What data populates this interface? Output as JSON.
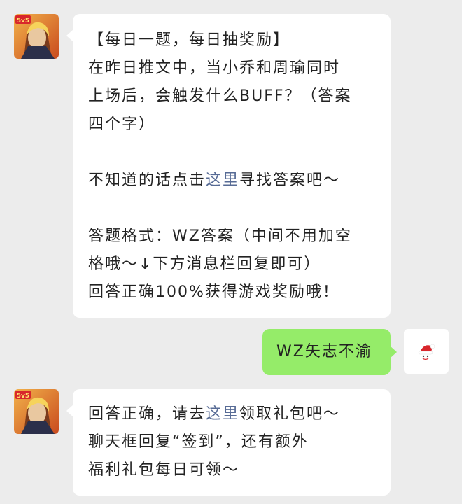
{
  "messages": [
    {
      "sender": "game-account",
      "lines": [
        "【每日一题，每日抽奖励】",
        "在昨日推文中，当小乔和周瑜同时",
        "上场后，会触发什么BUFF？（答案",
        "四个字）"
      ],
      "hint_pre": "不知道的话点击",
      "hint_link": "这里",
      "hint_post": "寻找答案吧～",
      "format_lines": [
        "答题格式：WZ答案（中间不用加空",
        "格哦～↓下方消息栏回复即可）",
        "回答正确100%获得游戏奖励哦！"
      ]
    },
    {
      "sender": "user",
      "text": "WZ矢志不渝"
    },
    {
      "sender": "game-account",
      "reply_pre": "回答正确，请去",
      "reply_link": "这里",
      "reply_post": "领取礼包吧～",
      "reply_lines": [
        "聊天框回复“签到”，还有额外",
        "福利礼包每日可领～"
      ]
    }
  ],
  "avatar_badge": "5v5",
  "colors": {
    "link": "#576b95",
    "user_bubble": "#95ec69",
    "background": "#ececec"
  },
  "icons": {
    "game_avatar": "hero-avatar-icon",
    "user_avatar": "santa-hat-avatar-icon"
  }
}
